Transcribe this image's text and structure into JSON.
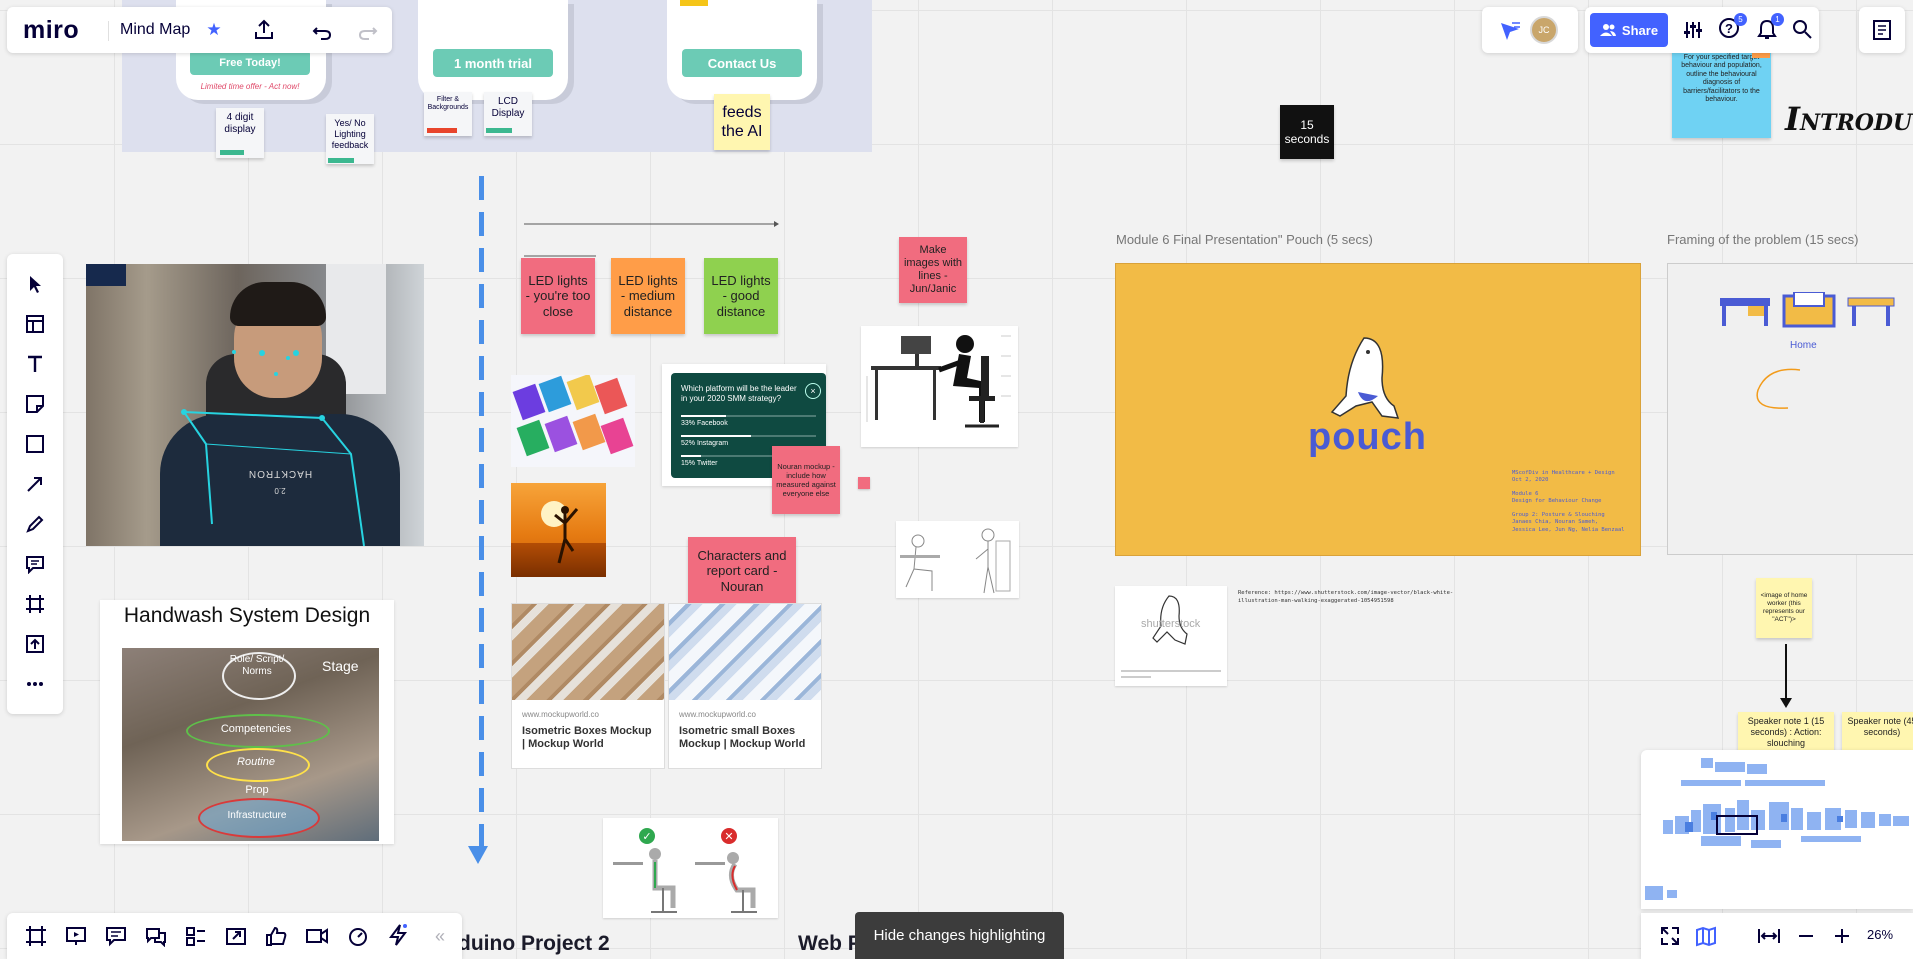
{
  "header": {
    "logo": "miro",
    "board_title": "Mind Map",
    "share_label": "Share",
    "avatar_initials": "JC",
    "help_badge": "5",
    "notif_badge": "1"
  },
  "pricing": {
    "btn_free": "Free Today!",
    "offer": "Limited time offer - Act now!",
    "btn_trial": "1 month trial",
    "btn_contact": "Contact Us"
  },
  "stickies": {
    "digit": "4 digit display",
    "lighting": "Yes/ No Lighting feedback",
    "filter": "Filter & Backgrounds",
    "lcd": "LCD Display",
    "feeds": "feeds the AI",
    "seconds": "15 seconds",
    "target": "For your specified target behaviour and population, outline the behavioural diagnosis of barriers/facilitators to the behaviour.",
    "led_close": "LED lights - you're too close",
    "led_medium": "LED lights - medium distance",
    "led_good": "LED lights - good distance",
    "make_images": "Make images with lines - Jun/Janic",
    "nouran_mockup": "Nouran mockup - include how measured against everyone else",
    "characters": "Characters and report card - Nouran",
    "home_worker": "<image of home worker (this represents our \"ACT\")>",
    "speaker1": "Speaker note 1 (15 seconds) : Action: slouching",
    "speaker2": "Speaker note (45 seconds)"
  },
  "frames": {
    "pouch_title": "Module 6 Final Presentation\" Pouch (5 secs)",
    "framing_title": "Framing of the problem (15 secs)",
    "intro_text": "Introdu",
    "pouch_word": "pouch",
    "pouch_meta": [
      "MScofDiv in Healthcare + Design",
      "Oct 2, 2020",
      "Module 6",
      "Design for Behaviour Change",
      "Group 2: Posture & Slouching",
      "Janaes Chia, Nouran Sameh,",
      "Jessica Lee, Jun Ng, Nelia Benzaal"
    ],
    "home_label": "Home",
    "shutter": "shutterstock",
    "reference": "Reference: https://www.shutterstock.com/image-vector/black-white-illustration-man-walking-exaggerated-1054951598"
  },
  "handwash": {
    "title": "Handwash System Design",
    "stage": "Stage",
    "role": "Role/ Script/ Norms",
    "competencies": "Competencies",
    "routine": "Routine",
    "prop": "Prop",
    "infrastructure": "Infrastructure"
  },
  "poll": {
    "question": "Which platform will be the leader in your 2020 SMM strategy?",
    "options": [
      {
        "label": "33% Facebook",
        "pct": 0.33
      },
      {
        "label": "52% Instagram",
        "pct": 0.52
      },
      {
        "label": "15% Twitter",
        "pct": 0.15
      }
    ]
  },
  "webcam": {
    "shirt_text": "HACKTRON",
    "shirt_sub": "2.0"
  },
  "links": [
    {
      "url": "www.mockupworld.co",
      "title": "Isometric Boxes Mockup | Mockup World"
    },
    {
      "url": "www.mockupworld.co",
      "title": "Isometric small Boxes Mockup | Mockup World"
    }
  ],
  "bottom": {
    "project2": "duino Project 2",
    "web_project": "Web Project",
    "hide_changes": "Hide changes highlighting",
    "collapse": "«"
  },
  "zoom": {
    "level": "26%"
  },
  "colors": {
    "accent": "#4262ff",
    "pink": "#f16c7f",
    "orange": "#ff9d48",
    "green": "#8fd14f",
    "yellow": "#fff9b1",
    "teal": "#6ccbb5",
    "pouch_bg": "#f2bb46"
  }
}
